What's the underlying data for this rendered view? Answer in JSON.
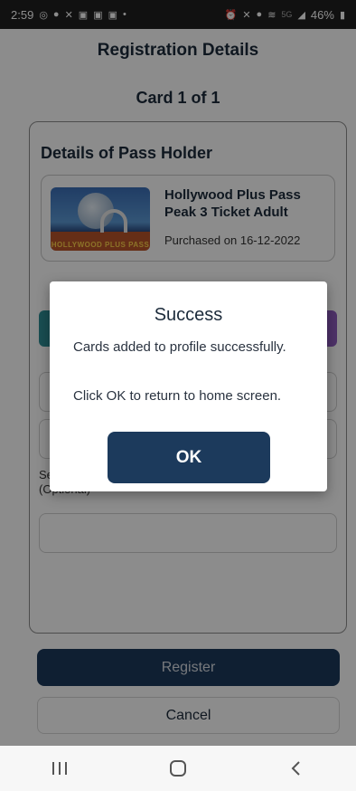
{
  "status_bar": {
    "time": "2:59",
    "left_icons": [
      "whatsapp-icon",
      "notification-icon",
      "app-icon",
      "app-icon",
      "app-icon",
      "app-icon",
      "dot-icon"
    ],
    "right_icons": [
      "alarm-icon",
      "mute-icon",
      "location-icon",
      "wifi-icon"
    ],
    "network": "5G",
    "battery": "46%"
  },
  "header": {
    "title": "Registration Details"
  },
  "card_count": "Card 1 of 1",
  "pass_holder": {
    "section_title": "Details of Pass Holder",
    "pass_name": "Hollywood Plus Pass Peak 3 Ticket Adult",
    "purchased": "Purchased on 16-12-2022",
    "image_brand_text": "HOLLYWOOD PLUS PASS"
  },
  "form": {
    "optional_label": "Se\n(Optional)"
  },
  "buttons": {
    "register": "Register",
    "cancel": "Cancel"
  },
  "dialog": {
    "title": "Success",
    "message_1": "Cards added to profile successfully.",
    "message_2": "Click OK to return to home screen.",
    "ok": "OK"
  },
  "nav": {
    "recent": "recent-apps-icon",
    "home": "home-icon",
    "back": "back-icon"
  },
  "colors": {
    "primary": "#1c3a5c",
    "text": "#1c2b3b",
    "overlay": "rgba(0,0,0,0.45)"
  }
}
